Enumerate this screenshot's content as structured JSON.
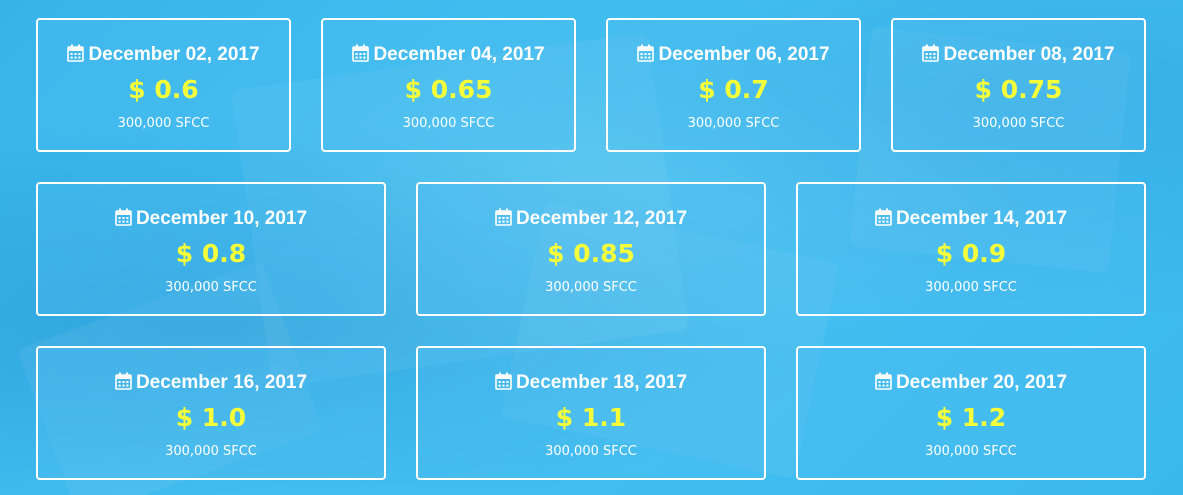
{
  "rounds": [
    {
      "date": "December 02, 2017",
      "price": "$ 0.6",
      "amount": "300,000 SFCC"
    },
    {
      "date": "December 04, 2017",
      "price": "$ 0.65",
      "amount": "300,000 SFCC"
    },
    {
      "date": "December 06, 2017",
      "price": "$ 0.7",
      "amount": "300,000 SFCC"
    },
    {
      "date": "December 08, 2017",
      "price": "$ 0.75",
      "amount": "300,000 SFCC"
    },
    {
      "date": "December 10, 2017",
      "price": "$ 0.8",
      "amount": "300,000 SFCC"
    },
    {
      "date": "December 12, 2017",
      "price": "$ 0.85",
      "amount": "300,000 SFCC"
    },
    {
      "date": "December 14, 2017",
      "price": "$ 0.9",
      "amount": "300,000 SFCC"
    },
    {
      "date": "December 16, 2017",
      "price": "$ 1.0",
      "amount": "300,000 SFCC"
    },
    {
      "date": "December 18, 2017",
      "price": "$ 1.1",
      "amount": "300,000 SFCC"
    },
    {
      "date": "December 20, 2017",
      "price": "$ 1.2",
      "amount": "300,000 SFCC"
    }
  ],
  "colors": {
    "background": "#3ebff0",
    "price": "#f5ff3a",
    "border": "#ffffff"
  },
  "icons": {
    "date": "calendar-icon"
  }
}
